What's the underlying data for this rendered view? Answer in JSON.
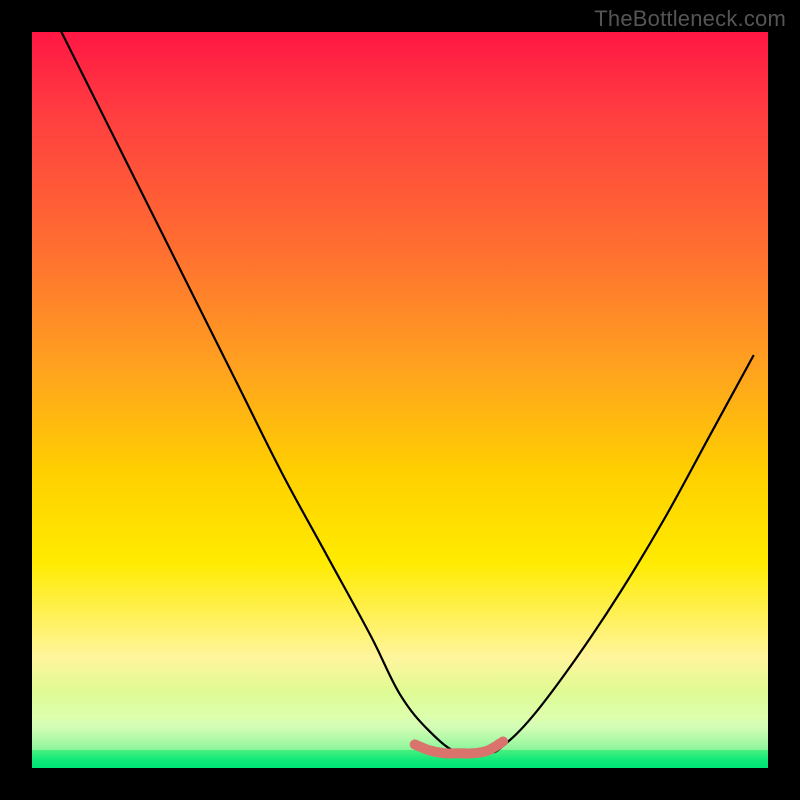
{
  "watermark": "TheBottleneck.com",
  "chart_data": {
    "type": "line",
    "title": "",
    "xlabel": "",
    "ylabel": "",
    "xlim": [
      0,
      100
    ],
    "ylim": [
      0,
      100
    ],
    "grid": false,
    "legend": false,
    "series": [
      {
        "name": "bottleneck-curve",
        "x": [
          4,
          10,
          16,
          22,
          28,
          34,
          40,
          46,
          50,
          54,
          58,
          62,
          64,
          68,
          74,
          80,
          86,
          92,
          98
        ],
        "y": [
          100,
          88,
          76,
          64,
          52,
          40,
          29,
          18,
          10,
          5,
          2,
          2,
          3,
          7,
          15,
          24,
          34,
          45,
          56
        ],
        "color": "#000000"
      },
      {
        "name": "optimal-zone-marker",
        "x": [
          52,
          54,
          56,
          58,
          60,
          62,
          64
        ],
        "y": [
          3.2,
          2.4,
          2.0,
          2.0,
          2.0,
          2.4,
          3.6
        ],
        "color": "#d9736b"
      }
    ],
    "background_gradient": {
      "top": "#ff1744",
      "mid": "#ffd000",
      "bottom": "#00e676"
    }
  }
}
